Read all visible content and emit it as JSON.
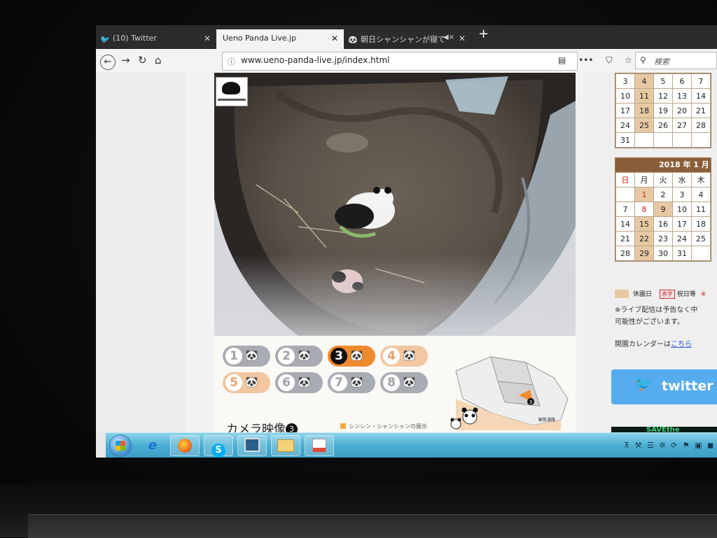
{
  "browser": {
    "tabs": [
      {
        "label": "(10) Twitter",
        "icon": "twitter-bird-icon"
      },
      {
        "label": "Ueno Panda Live.jp",
        "icon": "none"
      },
      {
        "label": "朝日シャンシャンが寝て",
        "icon": "panda-icon"
      }
    ],
    "new_tab": "+",
    "url": "www.ueno-panda-live.jp/index.html",
    "search_placeholder": "検索"
  },
  "camera_selector": {
    "buttons": [
      "1",
      "2",
      "3",
      "4",
      "5",
      "6",
      "7",
      "8"
    ],
    "active": "3",
    "heading": "カメラ映像",
    "heading_num": "3",
    "legend": "シンシン・シャンシャンの展示"
  },
  "map": {
    "marker": "3",
    "label": "観覧通路"
  },
  "calendar_dec": {
    "rows": [
      [
        "3",
        "4",
        "5",
        "6",
        "7"
      ],
      [
        "10",
        "11",
        "12",
        "13",
        "14"
      ],
      [
        "17",
        "18",
        "19",
        "20",
        "21"
      ],
      [
        "24",
        "25",
        "26",
        "27",
        "28"
      ],
      [
        "31",
        "",
        "",
        "",
        ""
      ]
    ],
    "closed_days": [
      "4",
      "11",
      "18",
      "25"
    ]
  },
  "calendar_jan": {
    "title": "2018 年 1 月",
    "weekdays": [
      "日",
      "月",
      "火",
      "水",
      "木"
    ],
    "rows": [
      [
        "",
        "1",
        "2",
        "3",
        "4"
      ],
      [
        "7",
        "8",
        "9",
        "10",
        "11"
      ],
      [
        "14",
        "15",
        "16",
        "17",
        "18"
      ],
      [
        "21",
        "22",
        "23",
        "24",
        "25"
      ],
      [
        "28",
        "29",
        "30",
        "31",
        ""
      ]
    ],
    "closed_days": [
      "1",
      "9",
      "15",
      "22",
      "29"
    ],
    "holiday_red": [
      "1",
      "8"
    ]
  },
  "legend": {
    "closed": "休園日",
    "red_tag": "赤字",
    "holiday": "祝日等",
    "mark": "※"
  },
  "notes": {
    "line1": "※ライブ配信は予告なく中",
    "line2": "可能性がございます。",
    "calendar_link_prefix": "開園カレンダーは",
    "calendar_link": "こちら"
  },
  "twitter_button": "twitter",
  "save_banner": "SAVEthe",
  "colors": {
    "calendar_brown": "#8a5e38",
    "closed_day": "#e6c9a2",
    "active_camera": "#f08a2e",
    "twitter_blue": "#55acee",
    "taskbar": "#4aaed3"
  }
}
